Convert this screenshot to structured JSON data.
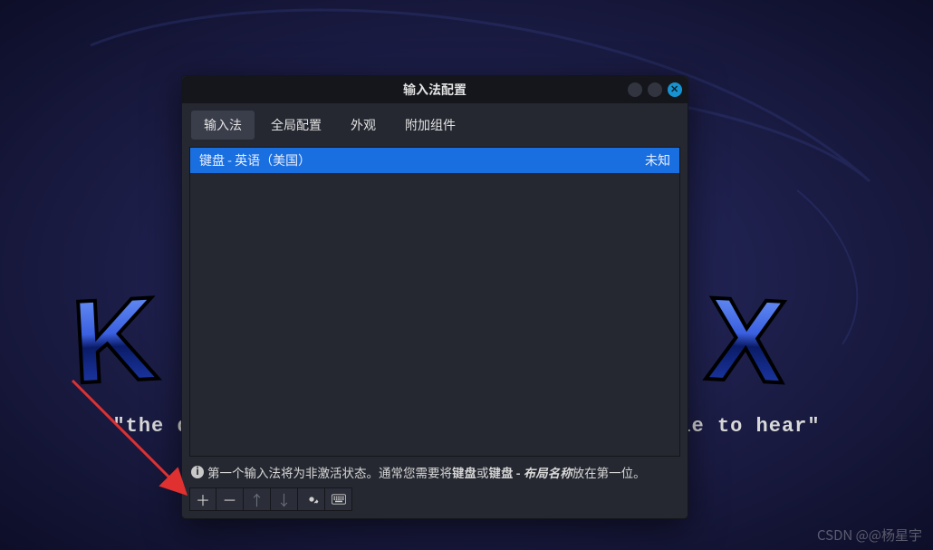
{
  "background": {
    "tagline": "\"the quieter you become, the more you are able to hear\""
  },
  "window": {
    "title": "输入法配置",
    "tabs": [
      {
        "label": "输入法",
        "active": true
      },
      {
        "label": "全局配置"
      },
      {
        "label": "外观"
      },
      {
        "label": "附加组件"
      }
    ],
    "list": {
      "items": [
        {
          "name": "键盘 - 英语（美国）",
          "status": "未知"
        }
      ]
    },
    "hint": {
      "pre": "第一个输入法将为非激活状态。通常您需要将",
      "b1": "键盘",
      "mid": "或",
      "b2": "键盘 - ",
      "ital": "布局名称",
      "post": "放在第一位。"
    },
    "toolbar": {
      "add": "＋",
      "remove": "－",
      "up": "↑",
      "down": "↓",
      "settings": "gear-icon",
      "keyboard": "keyboard-icon"
    }
  },
  "watermark": "CSDN @@杨星宇"
}
